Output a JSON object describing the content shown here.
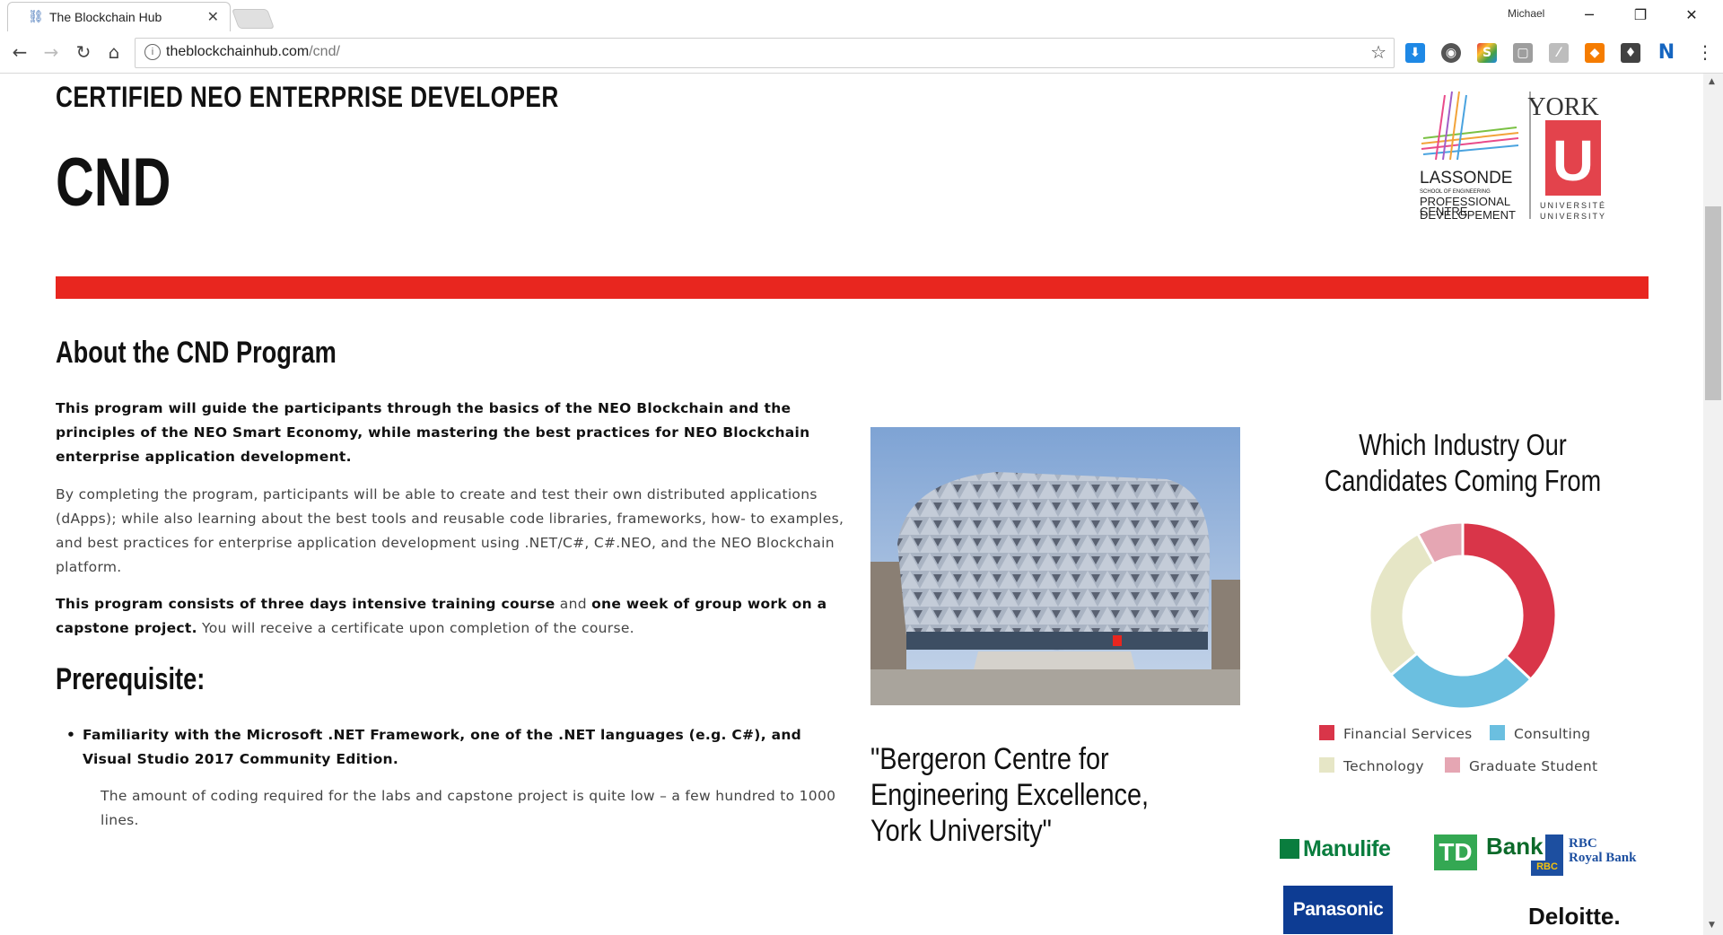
{
  "browser": {
    "tab_title": "The Blockchain Hub",
    "profile_name": "Michael",
    "url_host": "theblockchainhub.com",
    "url_path": "/cnd/"
  },
  "header": {
    "subtitle": "CERTIFIED NEO ENTERPRISE DEVELOPER",
    "acronym": "CND"
  },
  "logo": {
    "school_name": "LASSONDE",
    "school_sub": "SCHOOL OF ENGINEERING",
    "centre_line1": "PROFESSIONAL",
    "centre_line2": "DEVELOPEMENT",
    "centre_line3": "CENTRE",
    "university_top": "YORK",
    "university_mark": "U",
    "university_fr": "UNIVERSITÉ",
    "university_en": "UNIVERSITY"
  },
  "about": {
    "heading": "About the CND Program",
    "p1_bold": "This program will guide the participants through the basics of the NEO Blockchain and the principles of the NEO Smart Economy, while mastering the best practices for NEO Blockchain enterprise application development.",
    "p2": "By completing the program, participants will be able to create and test their own distributed applications (dApps); while also learning about the best tools and reusable code libraries, frameworks, how- to examples, and best practices for enterprise application development using .NET/C#, C#.NEO, and the NEO Blockchain platform.",
    "p3_bold1": "This program consists of three days intensive training course",
    "p3_mid": " and ",
    "p3_bold2": "one week of group work on a capstone project.",
    "p3_tail": " You will receive a certificate upon completion of the course."
  },
  "prerequisite": {
    "heading": "Prerequisite:",
    "item": "Familiarity with the Microsoft .NET Framework, one of the .NET languages (e.g. C#), and Visual Studio 2017 Community Edition.",
    "note": "The amount of coding required for the labs and capstone project is quite low – a few hundred to 1000 lines."
  },
  "photo_caption": "\"Bergeron Centre for Engineering Excellence, York University\"",
  "chart_data": {
    "type": "pie",
    "title": "Which Industry Our Candidates Coming From",
    "donut": true,
    "legend_position": "bottom",
    "series": [
      {
        "name": "Financial Services",
        "value": 37,
        "color": "#d93549"
      },
      {
        "name": "Consulting",
        "value": 27,
        "color": "#6bbfe0"
      },
      {
        "name": "Technology",
        "value": 28,
        "color": "#e6e6c6"
      },
      {
        "name": "Graduate Student",
        "value": 8,
        "color": "#e5a6b3"
      }
    ]
  },
  "sponsors": {
    "manulife": "Manulife",
    "td_mark": "TD",
    "td_bank": "Bank",
    "rbc_mark": "RBC",
    "rbc_line1": "RBC",
    "rbc_line2": "Royal Bank",
    "panasonic": "Panasonic",
    "deloitte": "Deloitte."
  }
}
